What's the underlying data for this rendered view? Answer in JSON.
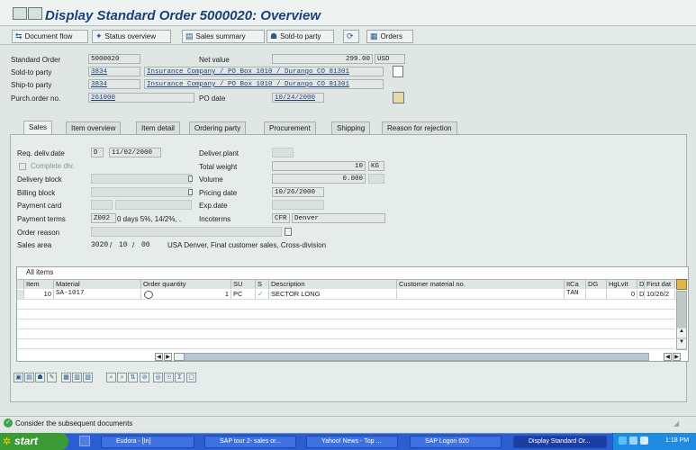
{
  "window": {
    "title": "Display Standard Order 5000020: Overview"
  },
  "app_toolbar": {
    "buttons": [
      {
        "label": "Document flow",
        "icon": "document-flow-icon"
      },
      {
        "label": "Status overview",
        "icon": "status-overview-icon"
      },
      {
        "label": "Sales summary",
        "icon": "sales-summary-icon"
      },
      {
        "label": "Sold-to party",
        "icon": "sold-to-party-icon"
      },
      {
        "label": "",
        "icon": "refresh-icon"
      },
      {
        "label": "Orders",
        "icon": "orders-icon"
      }
    ]
  },
  "header": {
    "standard_order_label": "Standard Order",
    "standard_order": "5000020",
    "net_value_label": "Net value",
    "net_value": "299.00",
    "currency": "USD",
    "sold_to_label": "Sold-to party",
    "sold_to": "3834",
    "sold_to_address": "Insurance Company / PO Box 1010 / Durango CO 81301",
    "ship_to_label": "Ship-to party",
    "ship_to": "3834",
    "ship_to_address": "Insurance Company / PO Box 1010 / Durango CO 81301",
    "purch_label": "Purch.order no.",
    "purch_order": "261000",
    "po_date_label": "PO date",
    "po_date": "10/24/2000"
  },
  "tabs": [
    "Sales",
    "Item overview",
    "Item detail",
    "Ordering party",
    "Procurement",
    "Shipping",
    "Reason for rejection"
  ],
  "active_tab": "Sales",
  "sales": {
    "req_deliv_date_label": "Req. deliv.date",
    "req_deliv_date_type": "D",
    "req_deliv_date": "11/02/2000",
    "complete_dlv_label": "Complete dlv.",
    "delivery_block_label": "Delivery block",
    "billing_block_label": "Billing block",
    "payment_card_label": "Payment card",
    "payment_terms_label": "Payment terms",
    "payment_terms": "Z002",
    "payment_terms_text": "0 days 5%, 14/2%, .",
    "order_reason_label": "Order reason",
    "sales_area_label": "Sales area",
    "sales_org": "3020",
    "dist_channel": "10",
    "division": "00",
    "sales_area_text": "USA Denver, Final customer sales, Cross-division",
    "deliver_plant_label": "Deliver.plant",
    "total_weight_label": "Total weight",
    "total_weight": "10",
    "weight_unit": "KG",
    "volume_label": "Volume",
    "volume": "0.000",
    "pricing_date_label": "Pricing date",
    "pricing_date": "10/26/2000",
    "exp_date_label": "Exp.date",
    "incoterms_label": "Incoterms",
    "incoterms": "CFR",
    "incoterms_place": "Denver"
  },
  "items_table": {
    "caption": "All items",
    "columns": [
      "Item",
      "Material",
      "Order quantity",
      "SU",
      "S",
      "Description",
      "Customer material no.",
      "ItCa",
      "DG",
      "HgLvIt",
      "D",
      "First dat"
    ],
    "rows": [
      {
        "item": "10",
        "material": "SA-1017",
        "qty": "1",
        "su": "PC",
        "description": "SECTOR LONG",
        "customer_material": "",
        "itca": "TAN",
        "dg": "",
        "hglvit": "0",
        "d": "D",
        "first_date": "10/26/2"
      }
    ]
  },
  "status": {
    "message": "Consider the subsequent documents"
  },
  "taskbar": {
    "start": "start",
    "tasks": [
      {
        "label": "Eudora - [In]"
      },
      {
        "label": "SAP tour 2- sales or..."
      },
      {
        "label": "Yahoo! News - Top ..."
      },
      {
        "label": "SAP Logon 620"
      },
      {
        "label": "Display Standard Or..."
      }
    ],
    "clock": "1:18 PM"
  }
}
